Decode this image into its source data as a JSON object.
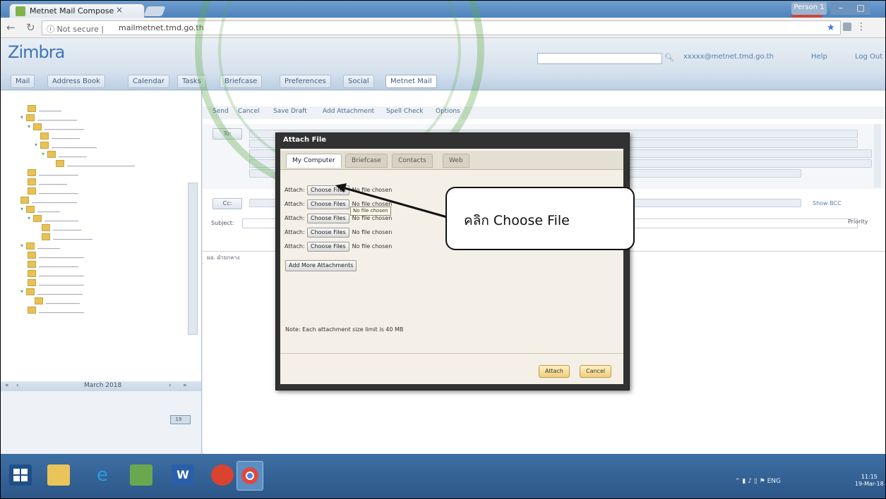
{
  "browser": {
    "tab_title": "Metnet Mail Compose",
    "tab_close": "×",
    "address_security": "Not secure",
    "address_url": "mailmetnet.tmd.go.th",
    "window_user": "Person 1"
  },
  "zimbra": {
    "logo": "Zimbra",
    "user_email": "xxxxx@metnet.tmd.go.th",
    "help_label": "Help",
    "logout_label": "Log Out",
    "app_tabs": [
      "Mail",
      "Address Book",
      "Calendar",
      "Tasks",
      "Briefcase",
      "Preferences",
      "Social",
      "Metnet Mail"
    ]
  },
  "compose": {
    "toolbar": [
      "Send",
      "Cancel",
      "Save Draft",
      "Add Attachment",
      "Spell Check",
      "Options"
    ],
    "to_label": "To:",
    "cc_label": "Cc:",
    "subject_label": "Subject:",
    "priority_label": "Priority",
    "show_bcc": "Show BCC",
    "body_text": "ผอ. ฝ่ายกลาง"
  },
  "sidebar": {
    "calendar_month": "March 2018",
    "calendar_nav": [
      "«",
      "‹",
      "›",
      "»"
    ],
    "today": "19"
  },
  "dialog": {
    "title": "Attach File",
    "tabs": [
      "My Computer",
      "Briefcase",
      "Contacts",
      "Web"
    ],
    "attach_label": "Attach:",
    "choose_button": "Choose Files",
    "no_file": "No file chosen",
    "tooltip": "No file chosen",
    "add_more": "Add More Attachments",
    "note": "Note: Each attachment size limit is 40 MB",
    "attach_button": "Attach",
    "cancel_button": "Cancel"
  },
  "callout": {
    "text": "คลิก Choose File"
  },
  "taskbar": {
    "tray_lang": "ENG",
    "clock_time": "11:15",
    "clock_date": "19-Mar-18"
  }
}
